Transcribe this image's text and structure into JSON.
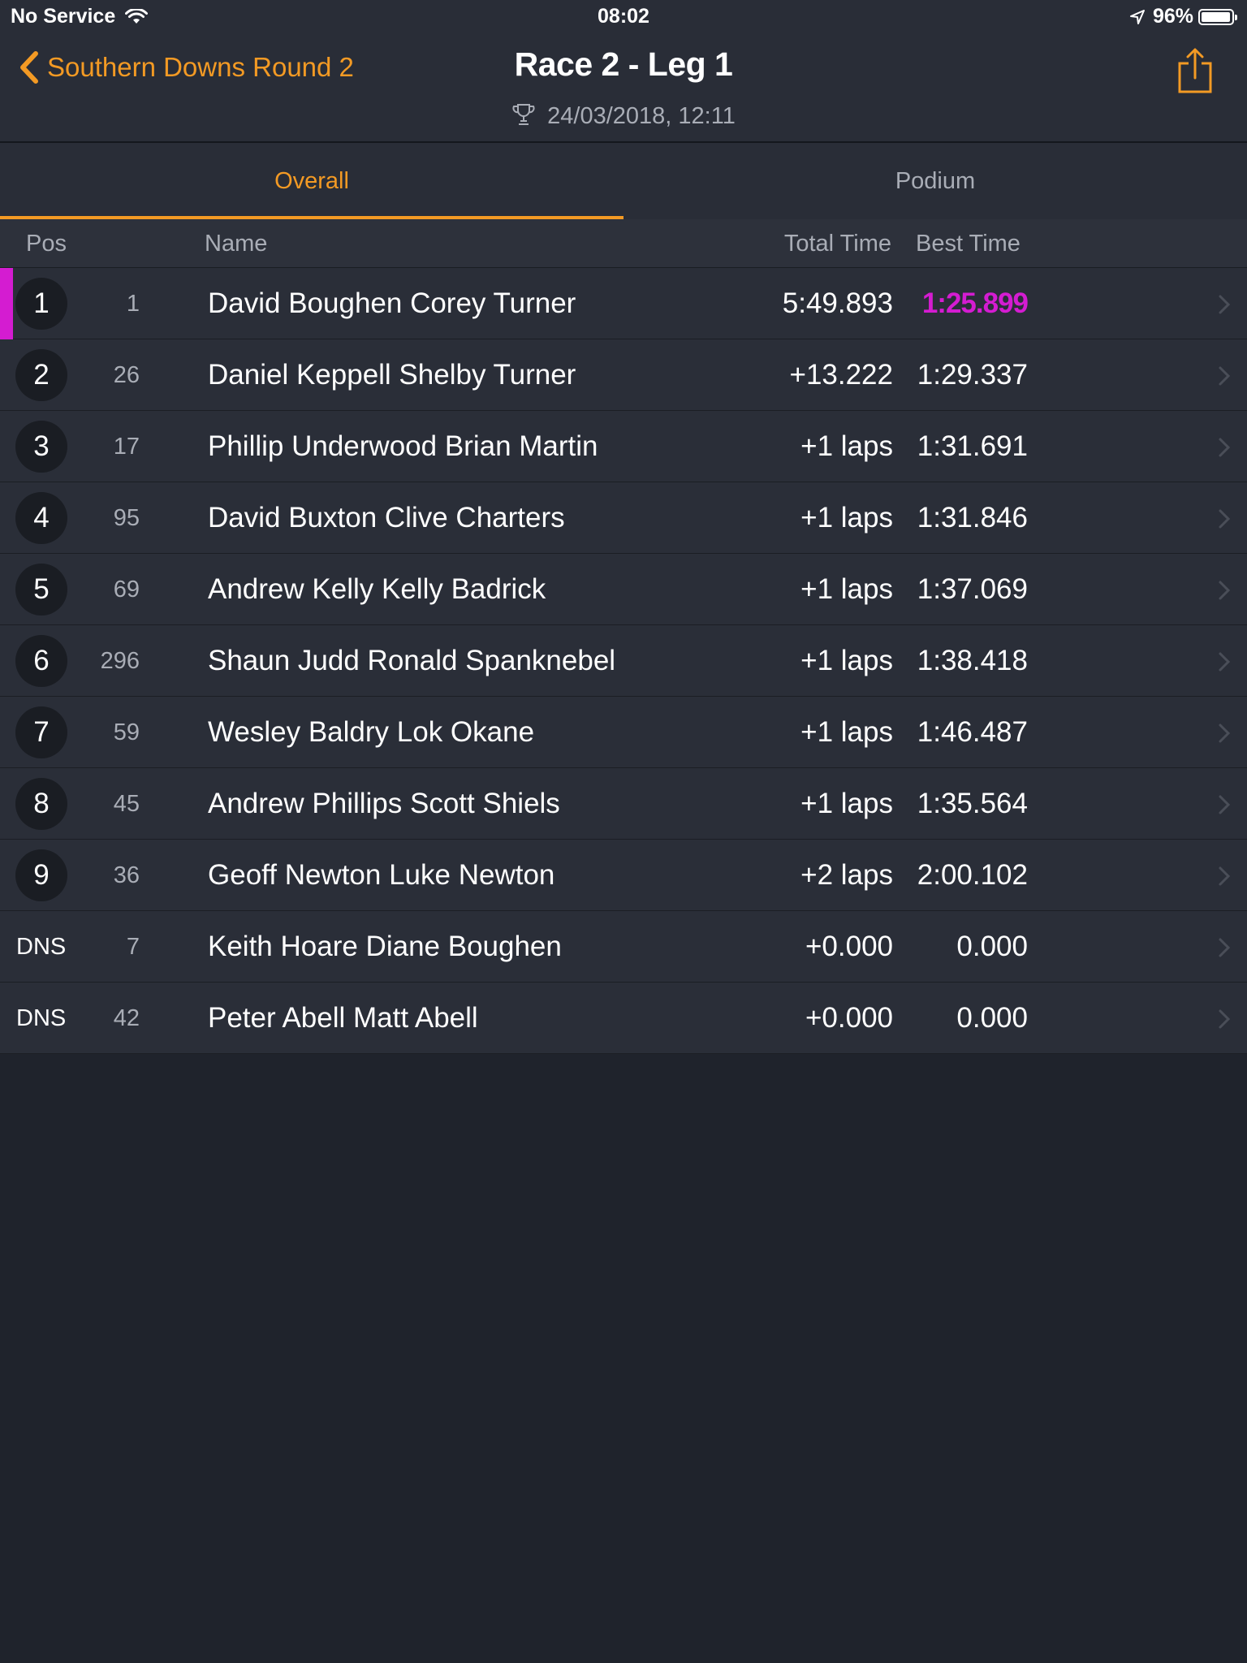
{
  "status_bar": {
    "carrier": "No Service",
    "time": "08:02",
    "battery_percent": "96%",
    "battery_level": 0.96
  },
  "nav": {
    "back_label": "Southern Downs Round 2",
    "title": "Race 2 -  Leg 1",
    "subtitle": "24/03/2018, 12:11"
  },
  "tabs": [
    {
      "label": "Overall",
      "active": true
    },
    {
      "label": "Podium",
      "active": false
    }
  ],
  "table": {
    "headers": {
      "pos": "Pos",
      "name": "Name",
      "total": "Total Time",
      "best": "Best Time"
    },
    "rows": [
      {
        "pos": "1",
        "num": "1",
        "name": "David Boughen Corey Turner",
        "total": "5:49.893",
        "best": "1:25.899"
      },
      {
        "pos": "2",
        "num": "26",
        "name": "Daniel Keppell Shelby Turner",
        "total": "+13.222",
        "best": "1:29.337"
      },
      {
        "pos": "3",
        "num": "17",
        "name": "Phillip Underwood Brian Martin",
        "total": "+1 laps",
        "best": "1:31.691"
      },
      {
        "pos": "4",
        "num": "95",
        "name": "David Buxton Clive Charters",
        "total": "+1 laps",
        "best": "1:31.846"
      },
      {
        "pos": "5",
        "num": "69",
        "name": "Andrew Kelly Kelly Badrick",
        "total": "+1 laps",
        "best": "1:37.069"
      },
      {
        "pos": "6",
        "num": "296",
        "name": "Shaun Judd Ronald Spanknebel",
        "total": "+1 laps",
        "best": "1:38.418"
      },
      {
        "pos": "7",
        "num": "59",
        "name": "Wesley Baldry Lok Okane",
        "total": "+1 laps",
        "best": "1:46.487"
      },
      {
        "pos": "8",
        "num": "45",
        "name": "Andrew Phillips Scott Shiels",
        "total": "+1 laps",
        "best": "1:35.564"
      },
      {
        "pos": "9",
        "num": "36",
        "name": "Geoff Newton Luke Newton",
        "total": "+2 laps",
        "best": "2:00.102"
      },
      {
        "pos": "DNS",
        "num": "7",
        "name": "Keith Hoare Diane Boughen",
        "total": "+0.000",
        "best": "0.000"
      },
      {
        "pos": "DNS",
        "num": "42",
        "name": "Peter Abell Matt Abell",
        "total": "+0.000",
        "best": "0.000"
      }
    ]
  },
  "colors": {
    "accent": "#f39a24",
    "fastest": "#d41cd1",
    "background": "#1f232c",
    "row": "#2a2e38"
  },
  "icons": {
    "back": "chevron-left-icon",
    "share": "share-icon",
    "trophy": "trophy-icon",
    "row": "chevron-right-icon",
    "wifi": "wifi-icon",
    "location": "location-arrow-icon",
    "battery": "battery-icon"
  }
}
